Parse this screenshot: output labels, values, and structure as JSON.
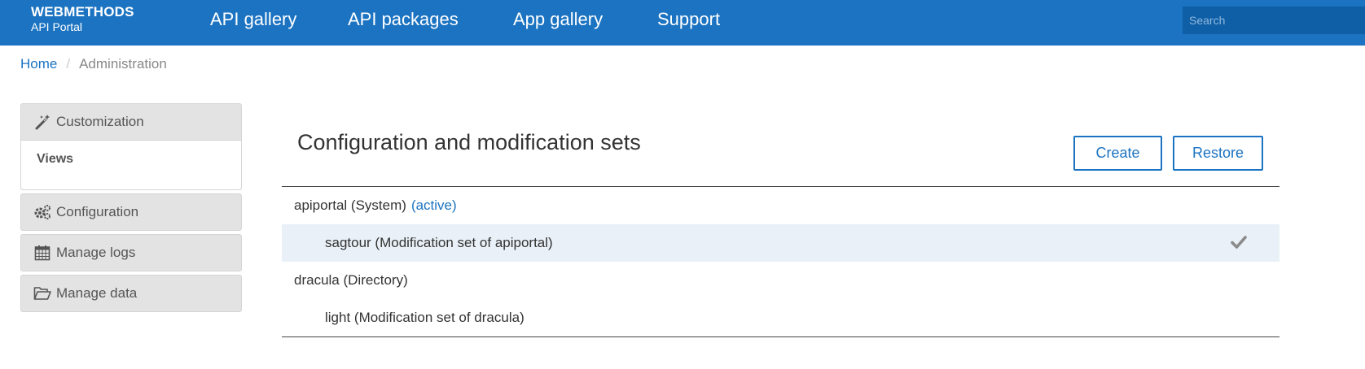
{
  "brand": {
    "title": "WEBMETHODS",
    "subtitle": "API Portal"
  },
  "nav": [
    "API gallery",
    "API packages",
    "App gallery",
    "Support"
  ],
  "search": {
    "placeholder": "Search"
  },
  "breadcrumb": {
    "home": "Home",
    "separator": "/",
    "current": "Administration"
  },
  "sidebar": {
    "customization": {
      "label": "Customization",
      "icon": "magic-wand-icon",
      "subitems": [
        "Views"
      ]
    },
    "items": [
      {
        "label": "Configuration",
        "icon": "gears-icon"
      },
      {
        "label": "Manage logs",
        "icon": "calendar-icon"
      },
      {
        "label": "Manage data",
        "icon": "folder-open-icon"
      }
    ]
  },
  "main": {
    "title": "Configuration and modification sets",
    "create_label": "Create",
    "restore_label": "Restore",
    "rows": [
      {
        "label": "apiportal (System)",
        "badge": "(active)",
        "level": "parent"
      },
      {
        "label": "sagtour (Modification set of apiportal)",
        "level": "child",
        "selected": true,
        "icon": "check-icon"
      },
      {
        "label": "dracula (Directory)",
        "level": "parent"
      },
      {
        "label": "light (Modification set of dracula)",
        "level": "child"
      }
    ]
  },
  "colors": {
    "brand_blue": "#1b73c1",
    "selected_row": "#e9f0f7",
    "panel_gray": "#e3e3e3"
  }
}
